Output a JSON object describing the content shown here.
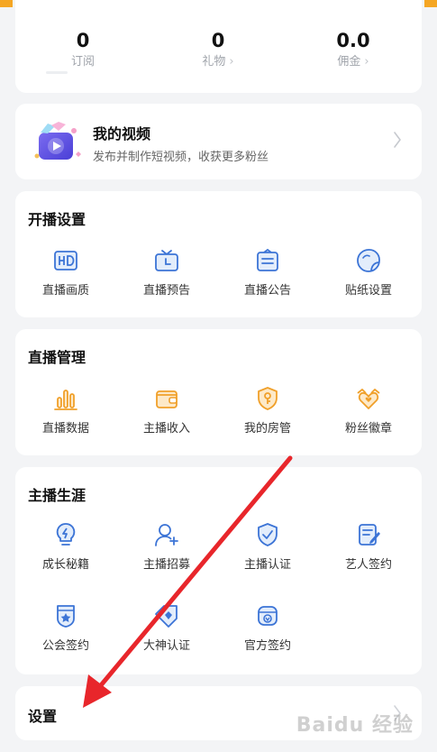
{
  "stats": [
    {
      "value": "0",
      "label": "订阅",
      "chevron": ""
    },
    {
      "value": "0",
      "label": "礼物",
      "chevron": "›"
    },
    {
      "value": "0.0",
      "label": "佣金",
      "chevron": "›"
    }
  ],
  "my_video": {
    "title": "我的视频",
    "description": "发布并制作短视频，收获更多粉丝"
  },
  "broadcast_settings": {
    "title": "开播设置",
    "items": [
      {
        "label": "直播画质",
        "icon": "hd-icon"
      },
      {
        "label": "直播预告",
        "icon": "tv-icon"
      },
      {
        "label": "直播公告",
        "icon": "announcement-icon"
      },
      {
        "label": "贴纸设置",
        "icon": "sticker-icon"
      }
    ]
  },
  "live_management": {
    "title": "直播管理",
    "items": [
      {
        "label": "直播数据",
        "icon": "bar-chart-icon"
      },
      {
        "label": "主播收入",
        "icon": "wallet-icon"
      },
      {
        "label": "我的房管",
        "icon": "shield-key-icon"
      },
      {
        "label": "粉丝徽章",
        "icon": "heart-badge-icon"
      }
    ]
  },
  "streamer_career": {
    "title": "主播生涯",
    "items": [
      {
        "label": "成长秘籍",
        "icon": "lightbulb-icon"
      },
      {
        "label": "主播招募",
        "icon": "add-user-icon"
      },
      {
        "label": "主播认证",
        "icon": "verified-shield-icon"
      },
      {
        "label": "艺人签约",
        "icon": "document-edit-icon"
      },
      {
        "label": "公会签约",
        "icon": "guild-badge-icon"
      },
      {
        "label": "大神认证",
        "icon": "diamond-tag-icon"
      },
      {
        "label": "官方签约",
        "icon": "official-seal-icon"
      }
    ]
  },
  "settings": {
    "title": "设置"
  },
  "watermark": "Baidu 经验",
  "colors": {
    "blue_icon": "#3c74d6",
    "orange_icon": "#f0a02a",
    "annotation_arrow": "#e8262b",
    "accent": "#f5a623"
  }
}
